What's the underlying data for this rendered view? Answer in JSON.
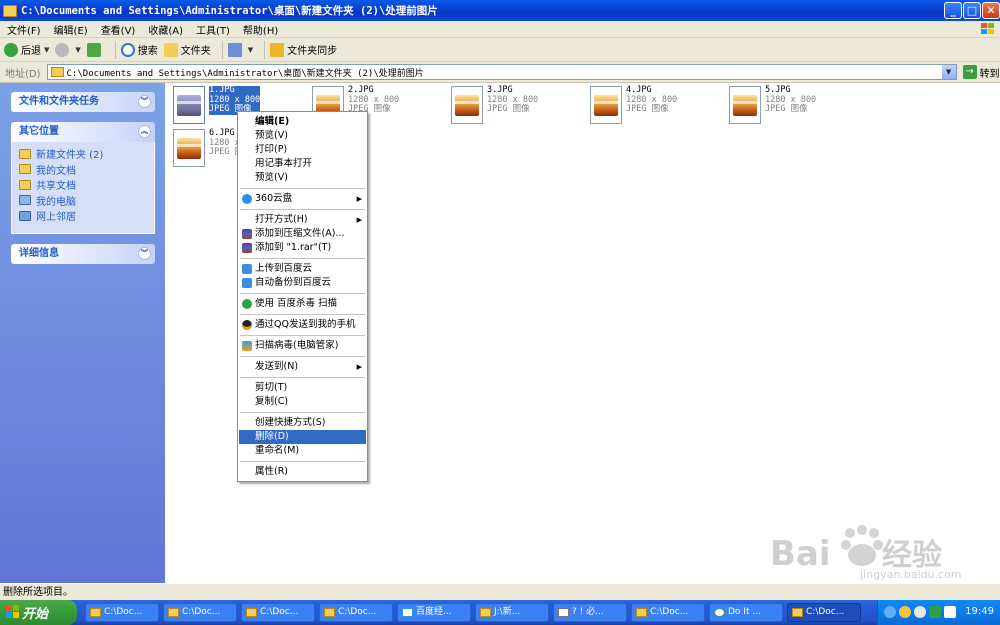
{
  "window": {
    "title": "C:\\Documents and Settings\\Administrator\\桌面\\新建文件夹 (2)\\处理前图片",
    "minimize": "_",
    "maximize": "□",
    "close": "✕"
  },
  "menubar": {
    "items": [
      "文件(F)",
      "编辑(E)",
      "查看(V)",
      "收藏(A)",
      "工具(T)",
      "帮助(H)"
    ]
  },
  "toolbar": {
    "back": "后退",
    "search": "搜索",
    "folders": "文件夹",
    "sync": "文件夹同步"
  },
  "address": {
    "label": "地址(D)",
    "path": "C:\\Documents and Settings\\Administrator\\桌面\\新建文件夹 (2)\\处理前图片",
    "go": "转到"
  },
  "leftpane": {
    "tasks_title": "文件和文件夹任务",
    "other_title": "其它位置",
    "other_places": [
      "新建文件夹 (2)",
      "我的文档",
      "共享文档",
      "我的电脑",
      "网上邻居"
    ],
    "details_title": "详细信息"
  },
  "files": [
    {
      "name": "1.JPG",
      "dims": "1280 x 800",
      "type": "JPEG 图像"
    },
    {
      "name": "2.JPG",
      "dims": "1280 x 800",
      "type": "JPEG 图像"
    },
    {
      "name": "3.JPG",
      "dims": "1280 x 800",
      "type": "JPEG 图像"
    },
    {
      "name": "4.JPG",
      "dims": "1280 x 800",
      "type": "JPEG 图像"
    },
    {
      "name": "5.JPG",
      "dims": "1280 x 800",
      "type": "JPEG 图像"
    },
    {
      "name": "6.JPG",
      "dims": "1280 x 800",
      "type": "JPEG 图像"
    }
  ],
  "context_menu": {
    "edit": "编辑(E)",
    "preview1": "预览(V)",
    "print": "打印(P)",
    "notepad": "用记事本打开",
    "preview2": "预览(V)",
    "cloud360": "360云盘",
    "open_with": "打开方式(H)",
    "add_archive": "添加到压缩文件(A)...",
    "add_rar": "添加到 \"1.rar\"(T)",
    "baidu_upload": "上传到百度云",
    "baidu_backup": "自动备份到百度云",
    "baidu_scan": "使用 百度杀毒 扫描",
    "qq_phone": "通过QQ发送到我的手机",
    "pc_manager": "扫描病毒(电脑管家)",
    "send_to": "发送到(N)",
    "cut": "剪切(T)",
    "copy": "复制(C)",
    "shortcut": "创建快捷方式(S)",
    "delete": "删除(D)",
    "rename": "重命名(M)",
    "properties": "属性(R)"
  },
  "statusbar": {
    "text": "删除所选项目。"
  },
  "taskbar": {
    "start": "开始",
    "tasks": [
      "C:\\Doc...",
      "C:\\Doc...",
      "C:\\Doc...",
      "C:\\Doc...",
      "百度经...",
      "J:\\新...",
      "? ! 必...",
      "C:\\Doc...",
      "Do It ...",
      "C:\\Doc..."
    ],
    "clock": "19:49"
  },
  "watermark": {
    "brand": "Baidu经验",
    "url": "jingyan.baidu.com"
  },
  "colors": {
    "titlebar": "#0a46d8",
    "selection": "#316ac5",
    "leftpane": "#7ba2e7",
    "link": "#215dc6"
  }
}
